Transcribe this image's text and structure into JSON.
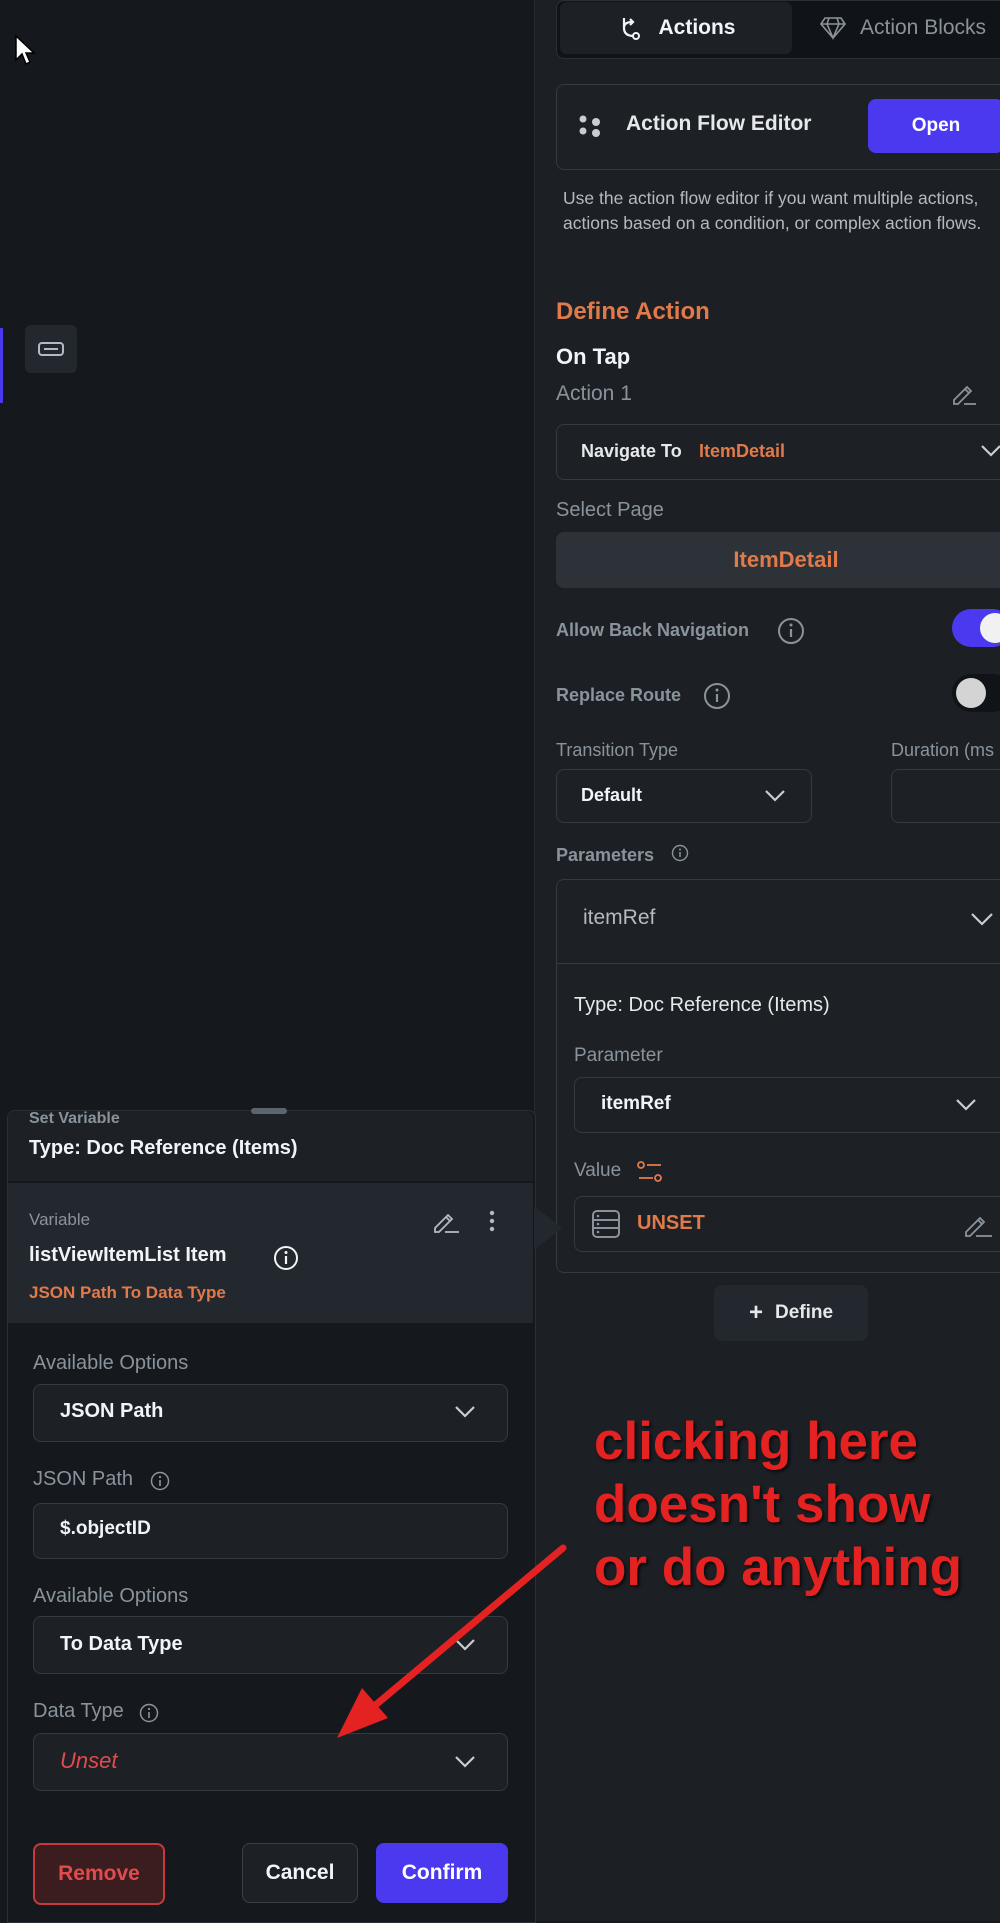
{
  "colors": {
    "accent": "#4b39ef",
    "orange": "#e07a4a",
    "danger": "#e24b4e",
    "annotation": "#e52222"
  },
  "tabs": [
    {
      "label": "Actions",
      "icon": "action-flow-icon",
      "active": true
    },
    {
      "label": "Action Blocks",
      "icon": "diamond-icon",
      "active": false
    }
  ],
  "action_flow": {
    "title": "Action Flow Editor",
    "open_label": "Open",
    "description": "Use the action flow editor if you want multiple actions, actions based on a condition, or complex action flows."
  },
  "define_action": {
    "title": "Define Action",
    "trigger": "On Tap",
    "action_name": "Action 1",
    "action_type": "Navigate To",
    "action_target": "ItemDetail",
    "select_page_label": "Select Page",
    "selected_page": "ItemDetail",
    "allow_back_navigation_label": "Allow Back Navigation",
    "allow_back_navigation": true,
    "replace_route_label": "Replace Route",
    "replace_route": false,
    "transition_type_label": "Transition Type",
    "transition_type_value": "Default",
    "duration_label": "Duration (ms",
    "parameters_label": "Parameters",
    "parameter_name": "itemRef",
    "param_type": "Type: Doc Reference (Items)",
    "parameter_label": "Parameter",
    "parameter_value": "itemRef",
    "value_label": "Value",
    "value_state": "UNSET",
    "define_label": "Define"
  },
  "set_variable": {
    "header_partial": "Set Variable",
    "type": "Type: Doc Reference (Items)",
    "variable_label": "Variable",
    "variable_name": "listViewItemList Item",
    "variable_transform": "JSON Path To Data Type",
    "available_options_label_1": "Available Options",
    "available_options_value_1": "JSON Path",
    "json_path_label": "JSON Path",
    "json_path_value": "$.objectID",
    "available_options_label_2": "Available Options",
    "available_options_value_2": "To Data Type",
    "data_type_label": "Data Type",
    "data_type_value": "Unset",
    "remove_label": "Remove",
    "cancel_label": "Cancel",
    "confirm_label": "Confirm"
  },
  "annotation": {
    "text": "clicking here\ndoesn't show\nor do anything"
  }
}
